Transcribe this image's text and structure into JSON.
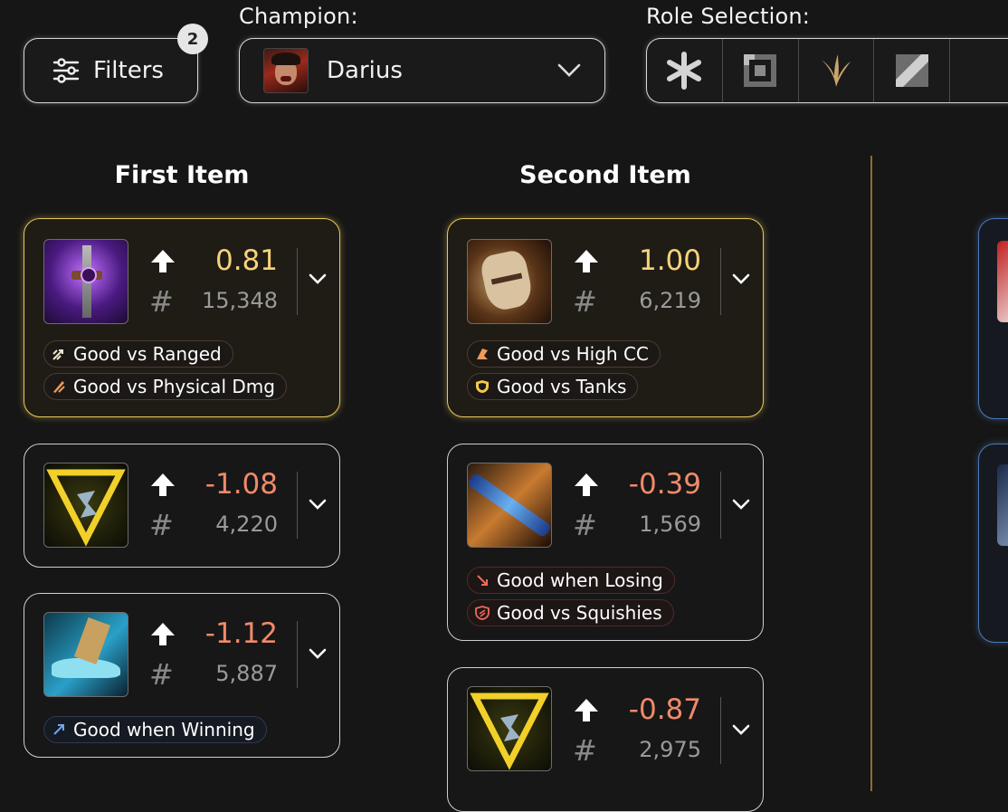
{
  "header": {
    "filters_label": "Filters",
    "filters_count": "2",
    "champion_label": "Champion:",
    "champion_name": "Darius",
    "role_label": "Role Selection:",
    "roles": [
      "all-roles-icon",
      "top-lane-icon",
      "jungle-icon",
      "mid-lane-icon"
    ]
  },
  "columns": [
    {
      "title": "First Item",
      "items": [
        {
          "score": "0.81",
          "count": "15,348",
          "best": true,
          "score_color": "#f6d27a",
          "icon": "purple-blade-item-icon",
          "tags": [
            {
              "label": "Good vs Ranged",
              "icon": "ranged-icon"
            },
            {
              "label": "Good vs Physical Dmg",
              "icon": "physical-damage-icon"
            }
          ]
        },
        {
          "score": "-1.08",
          "count": "4,220",
          "best": false,
          "score_color": "#f08a6a",
          "icon": "golden-triangle-item-icon",
          "tags": []
        },
        {
          "score": "-1.12",
          "count": "5,887",
          "best": false,
          "score_color": "#f08a6a",
          "icon": "blue-boots-item-icon",
          "tags": [
            {
              "label": "Good when Winning",
              "icon": "trend-up-icon"
            }
          ]
        }
      ]
    },
    {
      "title": "Second Item",
      "items": [
        {
          "score": "1.00",
          "count": "6,219",
          "best": true,
          "score_color": "#f6d27a",
          "icon": "bronze-helmet-item-icon",
          "tags": [
            {
              "label": "Good vs High CC",
              "icon": "high-cc-icon"
            },
            {
              "label": "Good vs Tanks",
              "icon": "tank-shield-icon"
            }
          ]
        },
        {
          "score": "-0.39",
          "count": "1,569",
          "best": false,
          "score_color": "#f08a6a",
          "icon": "blue-spear-item-icon",
          "tags": [
            {
              "label": "Good when Losing",
              "icon": "trend-down-icon"
            },
            {
              "label": "Good vs Squishies",
              "icon": "squishy-icon"
            }
          ]
        },
        {
          "score": "-0.87",
          "count": "2,975",
          "best": false,
          "score_color": "#f08a6a",
          "icon": "golden-triangle-item-icon",
          "tags": []
        }
      ]
    }
  ],
  "colors": {
    "accent_gold": "#e8c75a",
    "negative": "#f08a6a",
    "positive": "#f6d27a",
    "third_column_accent": "#4b78b8"
  }
}
